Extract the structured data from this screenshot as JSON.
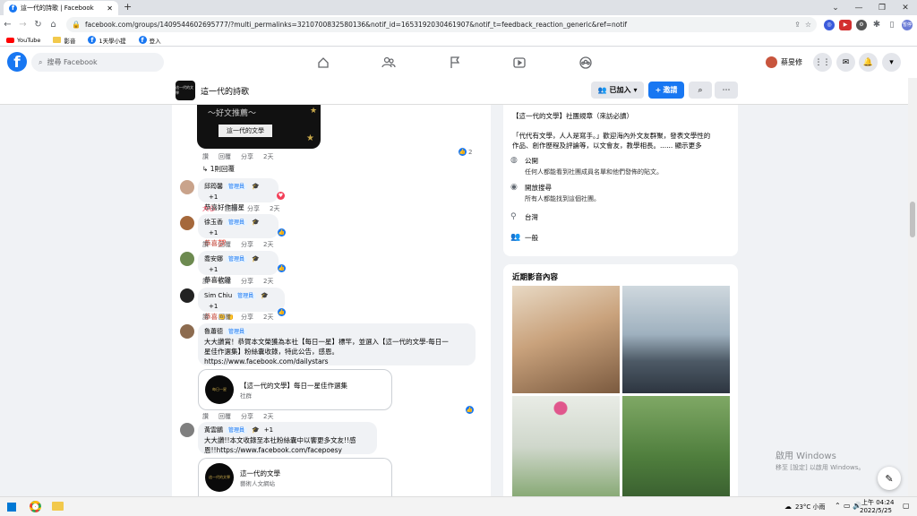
{
  "browser": {
    "tab_title": "這一代的詩歌 | Facebook",
    "new_tab": "+",
    "url": "facebook.com/groups/1409544602695777/?multi_permalinks=3210700832580136&notif_id=1653192030461907&notif_t=feedback_reaction_generic&ref=notif",
    "profile_label": "暫停",
    "bookmarks": [
      {
        "label": "YouTube",
        "icon": "youtube-icon"
      },
      {
        "label": "影音",
        "icon": "folder-icon"
      },
      {
        "label": "1天學小提",
        "icon": "facebook-icon"
      },
      {
        "label": "登入",
        "icon": "facebook-icon"
      }
    ]
  },
  "facebook": {
    "search_placeholder": "搜尋 Facebook",
    "user_name": "蔡旻修"
  },
  "group": {
    "thumb_text": "這一代的文學",
    "name": "這一代的詩歌",
    "joined_label": "已加入",
    "invite_label": "邀請"
  },
  "feed": {
    "image_banner": "〜好文推薦〜",
    "image_logo": "這一代的文學",
    "top_actions": {
      "like": "讚",
      "reply": "回覆",
      "share": "分享",
      "time": "2天"
    },
    "top_reaction_count": "2",
    "replies_link": "1則回覆",
    "comments": [
      {
        "name": "邱筠馨",
        "badge": "管理員",
        "plus": "+1",
        "text": "恭喜好作摘星",
        "reaction_label": "大心",
        "reply": "回覆",
        "share": "分享",
        "time": "2天",
        "reaction": "heart"
      },
      {
        "name": "徐玉香",
        "badge": "管理員",
        "plus": "+1",
        "text": "恭喜💯",
        "like": "讚",
        "reply": "回覆",
        "share": "分享",
        "time": "2天",
        "reaction": "like"
      },
      {
        "name": "喬安娜",
        "badge": "管理員",
        "plus": "+1",
        "text": "恭喜收錄",
        "like": "讚",
        "reply": "回覆",
        "share": "分享",
        "time": "2天",
        "reaction": "like"
      },
      {
        "name": "Sim Chiu",
        "badge": "管理員",
        "plus": "+1",
        "text": "恭喜👏👏",
        "like": "讚",
        "reply": "回覆",
        "share": "分享",
        "time": "2天",
        "reaction": "like"
      }
    ],
    "admin_comment": {
      "name": "魯蕭德",
      "badge": "管理員",
      "line1": "大大讚賞！恭賀本文榮獲為本社【每日一星】標竿，並選入【這一代的文學-每日一",
      "line2": "星佳作選集】粉絲囊收錄，特此公告，感恩。",
      "link": "https://www.facebook.com/dailystars",
      "card_title": "【這一代的文學】每日一星佳作選集",
      "card_sub": "社群",
      "card_img": "每日一星",
      "like": "讚",
      "reply": "回覆",
      "share": "分享",
      "time": "2天"
    },
    "last_comment": {
      "name": "黃雲鵬",
      "badge": "管理員",
      "plus": "+1",
      "line1": "大大讚!!本文收錄至本社粉絲囊中以饗更多文友!!感",
      "line2": "恩!!https://www.facebook.com/facepoesy",
      "card_title": "這一代的文學",
      "card_sub": "藝術人文網站",
      "card_img": "這一代的文學"
    }
  },
  "about": {
    "rules": "【這一代的文學】社團規章（來訪必讀）",
    "desc1": "「代代有文學，人人是寫手。」歡迎海內外文友群聚，發表文學性的",
    "desc2": "作品、創作歷程及評論等，以文會友，教學相長。...... 顯示更多",
    "rows": [
      {
        "icon": "globe-icon",
        "title": "公開",
        "sub": "任何人都能看到社團成員名單和他們發佈的貼文。"
      },
      {
        "icon": "eye-icon",
        "title": "開放搜尋",
        "sub": "所有人都能找到這個社團。"
      },
      {
        "icon": "location-icon",
        "title": "台灣",
        "sub": ""
      },
      {
        "icon": "group-icon",
        "title": "一般",
        "sub": ""
      }
    ]
  },
  "media": {
    "title": "近期影音內容"
  },
  "watermark": {
    "line1": "啟用 Windows",
    "line2": "移至 [設定] 以啟用 Windows。"
  },
  "taskbar": {
    "weather": "23°C 小雨",
    "ime": "中",
    "time": "上午 04:24",
    "date": "2022/5/25"
  },
  "colors": {
    "fb_blue": "#1877f2",
    "accent_bg": "#e7f3ff",
    "heart": "#f33e58"
  }
}
